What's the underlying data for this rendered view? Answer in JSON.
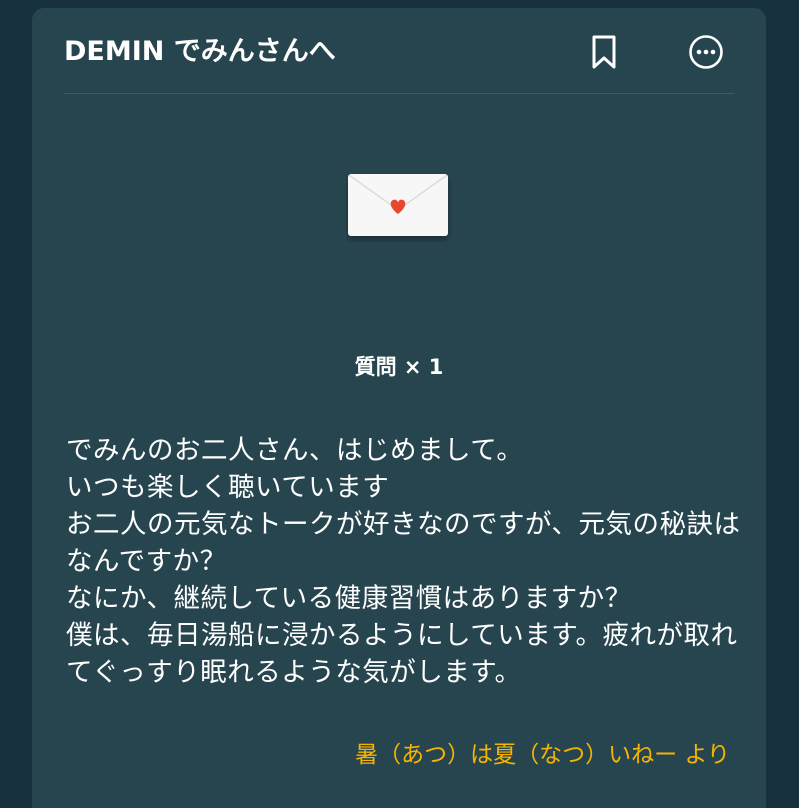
{
  "header": {
    "title": "DEMIN でみんさんへ",
    "bookmark_icon": "bookmark-icon",
    "more_icon": "more-options-icon"
  },
  "envelope": {
    "icon": "envelope-heart-icon",
    "heart_color": "#e8492e"
  },
  "question": {
    "count_label": "質問 × 1"
  },
  "message": {
    "body": "でみんのお二人さん、はじめまして。\nいつも楽しく聴いています\nお二人の元気なトークが好きなのですが、元気の秘訣はなんですか？\nなにか、継続している健康習慣はありますか？\n僕は、毎日湯船に浸かるようにしています。疲れが取れてぐっすり眠れるような気がします。",
    "sender": "暑（あつ）は夏（なつ）いねー より"
  },
  "colors": {
    "background": "#16313d",
    "card": "#27454e",
    "text": "#ffffff",
    "accent": "#f4b400"
  }
}
